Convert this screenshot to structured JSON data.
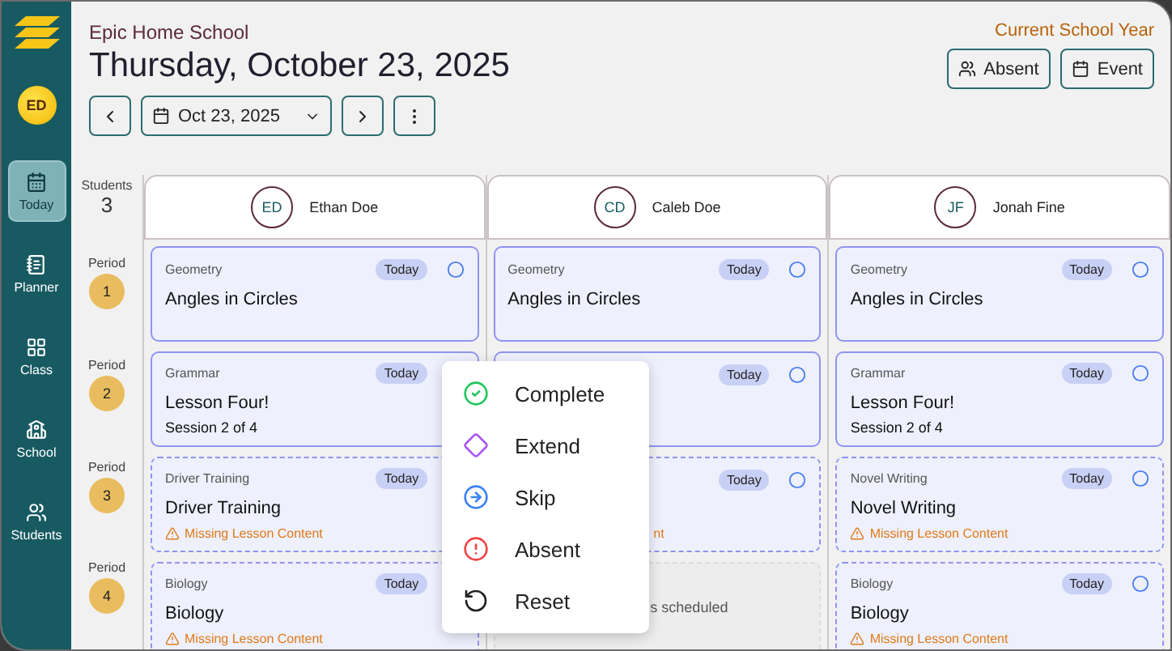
{
  "app": {
    "school_name": "Epic Home School",
    "title": "Thursday, October 23, 2025",
    "user_initials": "ED",
    "date_picker": "Oct 23, 2025",
    "school_year": "Current School Year"
  },
  "actions": [
    {
      "label": "Absent",
      "kind": "absent"
    },
    {
      "label": "Event",
      "kind": "event"
    }
  ],
  "sidebar": {
    "items": [
      {
        "label": "Today",
        "kind": "today",
        "selected": true
      },
      {
        "label": "Planner",
        "kind": "planner",
        "selected": false
      },
      {
        "label": "Class",
        "kind": "class",
        "selected": false
      },
      {
        "label": "School",
        "kind": "school",
        "selected": false
      },
      {
        "label": "Students",
        "kind": "students",
        "selected": false
      }
    ]
  },
  "students_label": "Students",
  "students_count": "3",
  "periods": [
    {
      "label": "Period",
      "number": "1"
    },
    {
      "label": "Period",
      "number": "2"
    },
    {
      "label": "Period",
      "number": "3"
    },
    {
      "label": "Period",
      "number": "4"
    }
  ],
  "students": [
    {
      "initials": "ED",
      "name": "Ethan Doe",
      "lessons": [
        {
          "kind": "lesson",
          "subject": "Geometry",
          "badge": "Today",
          "title": "Angles in Circles"
        },
        {
          "kind": "lesson",
          "subject": "Grammar",
          "badge": "Today",
          "title": "Lesson Four!",
          "session": "Session 2 of 4"
        },
        {
          "kind": "lesson",
          "subject": "Driver Training",
          "badge": "Today",
          "title": "Driver Training",
          "warning": "Missing Lesson Content"
        },
        {
          "kind": "lesson",
          "subject": "Biology",
          "badge": "Today",
          "title": "Biology",
          "warning": "Missing Lesson Content"
        }
      ]
    },
    {
      "initials": "CD",
      "name": "Caleb Doe",
      "lessons": [
        {
          "kind": "lesson",
          "subject": "Geometry",
          "badge": "Today",
          "title": "Angles in Circles"
        },
        {
          "kind": "lesson",
          "badge": "Today"
        },
        {
          "kind": "lesson",
          "badge": "Today",
          "warning": "nt",
          "covered": true
        },
        {
          "kind": "empty",
          "text": "s scheduled",
          "covered": true
        }
      ]
    },
    {
      "initials": "JF",
      "name": "Jonah Fine",
      "lessons": [
        {
          "kind": "lesson",
          "subject": "Geometry",
          "badge": "Today",
          "title": "Angles in Circles"
        },
        {
          "kind": "lesson",
          "subject": "Grammar",
          "badge": "Today",
          "title": "Lesson Four!",
          "session": "Session 2 of 4"
        },
        {
          "kind": "lesson",
          "subject": "Novel Writing",
          "badge": "Today",
          "title": "Novel Writing",
          "warning": "Missing Lesson Content"
        },
        {
          "kind": "lesson",
          "subject": "Biology",
          "badge": "Today",
          "title": "Biology",
          "warning": "Missing Lesson Content"
        }
      ]
    }
  ],
  "menu": {
    "items": [
      {
        "label": "Complete",
        "kind": "complete"
      },
      {
        "label": "Extend",
        "kind": "extend"
      },
      {
        "label": "Skip",
        "kind": "skip"
      },
      {
        "label": "Absent",
        "kind": "absent"
      },
      {
        "label": "Reset",
        "kind": "reset"
      }
    ]
  }
}
